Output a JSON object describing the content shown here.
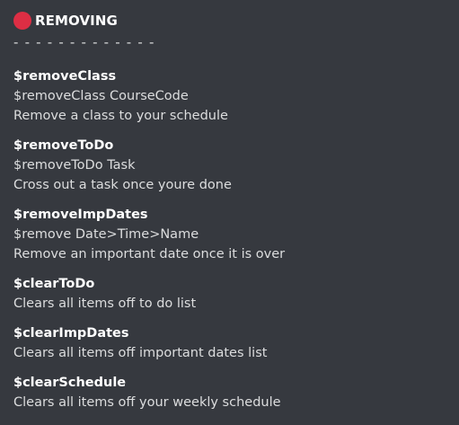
{
  "section": {
    "title": "REMOVING",
    "separator": "- - - - - - - - - - - - -"
  },
  "commands": [
    {
      "name": "$removeClass",
      "lines": [
        "$removeClass CourseCode",
        "Remove a class to your schedule"
      ]
    },
    {
      "name": "$removeToDo",
      "lines": [
        "$removeToDo Task",
        "Cross out a task once youre done"
      ]
    },
    {
      "name": "$removeImpDates",
      "lines": [
        "$remove Date>Time>Name",
        "Remove an important date once it is over"
      ]
    },
    {
      "name": "$clearToDo",
      "lines": [
        "Clears all items off to do list"
      ]
    },
    {
      "name": "$clearImpDates",
      "lines": [
        "Clears all items off important dates list"
      ]
    },
    {
      "name": "$clearSchedule",
      "lines": [
        "Clears all items off your weekly schedule"
      ]
    }
  ],
  "colors": {
    "background": "#36393f",
    "text": "#dcddde",
    "bold_text": "#ffffff",
    "red_circle": "#dd2e44"
  },
  "icons": {
    "header": "red-circle-icon"
  }
}
